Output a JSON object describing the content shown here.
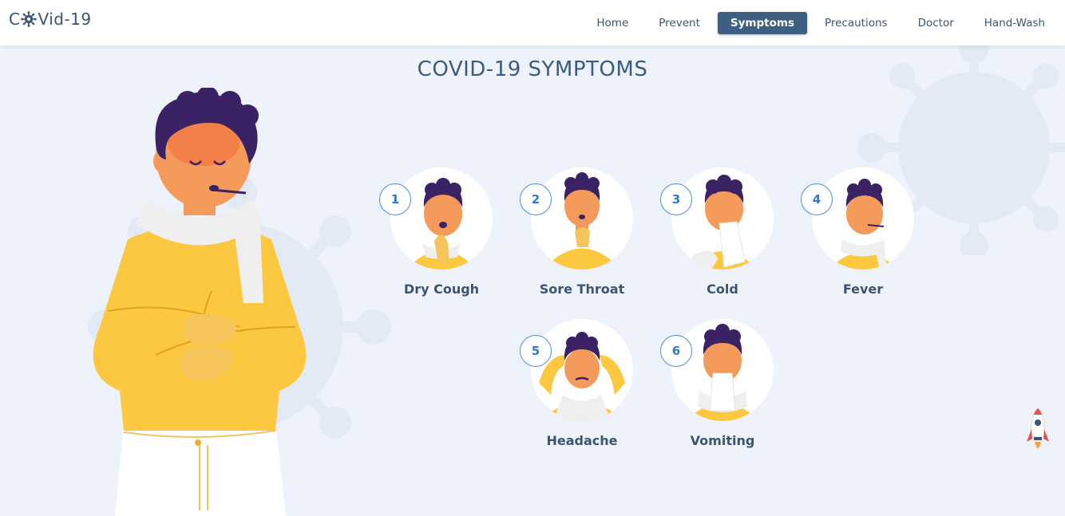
{
  "brand": {
    "prefix": "C",
    "suffix": "Vid-19",
    "icon": "virus-icon"
  },
  "nav": {
    "items": [
      {
        "label": "Home",
        "active": false
      },
      {
        "label": "Prevent",
        "active": false
      },
      {
        "label": "Symptoms",
        "active": true
      },
      {
        "label": "Precautions",
        "active": false
      },
      {
        "label": "Doctor",
        "active": false
      },
      {
        "label": "Hand-Wash",
        "active": false
      }
    ]
  },
  "page": {
    "title": "COVID-19 SYMPTOMS"
  },
  "symptoms": [
    {
      "number": "1",
      "label": "Dry Cough"
    },
    {
      "number": "2",
      "label": "Sore Throat"
    },
    {
      "number": "3",
      "label": "Cold"
    },
    {
      "number": "4",
      "label": "Fever"
    },
    {
      "number": "5",
      "label": "Headache"
    },
    {
      "number": "6",
      "label": "Vomiting"
    }
  ],
  "colors": {
    "accent": "#3d6082",
    "number_ring": "#4a8fd9",
    "background": "#eef3fb",
    "sweater": "#fcc840",
    "hair": "#3b2265",
    "skin": "#f49a5a"
  },
  "icons": {
    "scroll_top": "rocket-icon"
  }
}
